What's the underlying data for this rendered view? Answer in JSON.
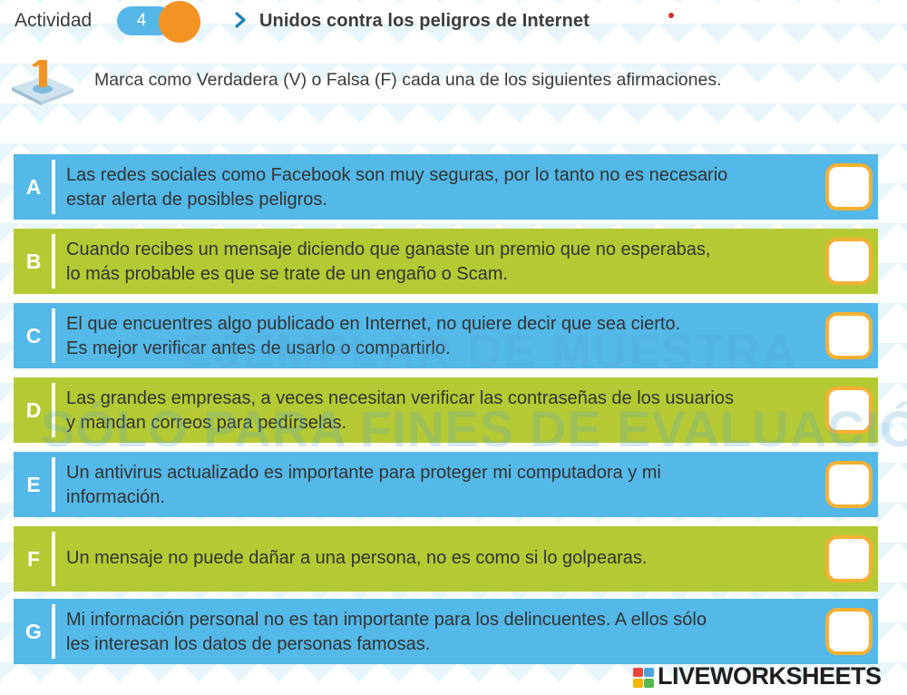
{
  "header": {
    "activity_label": "Actividad",
    "activity_number": "4",
    "unit_title": "Unidos contra los peligros de Internet"
  },
  "instruction": {
    "step": "1",
    "text": "Marca como Verdadera (V) o Falsa (F)  cada una de los siguientes afirmaciones."
  },
  "statements": [
    {
      "letter": "A",
      "color": "blue",
      "line1": "Las redes sociales como Facebook son muy seguras, por lo tanto no es necesario",
      "line2": "estar alerta de posibles peligros.",
      "answer": ""
    },
    {
      "letter": "B",
      "color": "green",
      "line1": "Cuando recibes un mensaje diciendo que ganaste un premio que no esperabas,",
      "line2": "lo más probable es que se trate de un engaño o Scam.",
      "answer": ""
    },
    {
      "letter": "C",
      "color": "blue",
      "line1": "El que encuentres algo publicado en Internet, no quiere decir que sea cierto.",
      "line2": "Es mejor verificar antes de usarlo o compartirlo.",
      "answer": ""
    },
    {
      "letter": "D",
      "color": "green",
      "line1": "Las grandes empresas, a veces necesitan verificar las contraseñas de los usuarios",
      "line2": "y mandan correos para pedírselas.",
      "answer": ""
    },
    {
      "letter": "E",
      "color": "blue",
      "line1": "Un antivirus actualizado es importante para proteger mi computadora y mi",
      "line2": "información.",
      "answer": ""
    },
    {
      "letter": "F",
      "color": "green",
      "line1": "Un mensaje no puede dañar a una persona, no es como si lo golpearas.",
      "line2": "",
      "answer": ""
    },
    {
      "letter": "G",
      "color": "blue",
      "line1": "Mi información personal no es tan importante para los delincuentes. A ellos sólo",
      "line2": "les interesan los datos de personas famosas.",
      "answer": ""
    }
  ],
  "watermark": {
    "line1": "EJEMPLAR DE MUESTRA",
    "line2": "SÓLO PARA FINES DE EVALUACIÓN"
  },
  "brand": {
    "logo_letters": "LIVE",
    "name": "LIVEWORKSHEETS"
  },
  "colors": {
    "row_blue": "#54b8e8",
    "row_green": "#b5c934",
    "accent_orange": "#f39324",
    "answer_border": "#f5b033"
  },
  "icons": {
    "breadcrumb": "chevron-right-icon",
    "step": "step-number-icon"
  }
}
